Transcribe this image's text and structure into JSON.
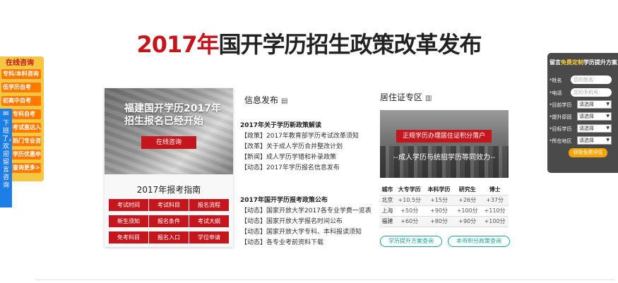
{
  "title": {
    "year": "2017年",
    "rest": "国开学历招生政策改革发布"
  },
  "left_float": {
    "title": "在线咨询",
    "items": [
      "专科/本科咨询",
      "低学历自考",
      "初高中自考",
      "专科自考",
      "考试直达入口",
      "热门专业咨询",
      "学历优惠申请",
      "查询更多>>"
    ],
    "strip_text": "下班了，欢迎留言咨询"
  },
  "right_float": {
    "header_pre": "留言",
    "header_hl": "免费定制",
    "header_post": "学历提升方案",
    "name_label": "*姓名",
    "name_placeholder": "您的姓名：",
    "phone_label": "*电话",
    "phone_placeholder": "您的手机号：",
    "rows": [
      {
        "label": "*目前学历",
        "value": "请选择"
      },
      {
        "label": "*提升原因",
        "value": "请选择"
      },
      {
        "label": "*目标学历",
        "value": "请选择"
      },
      {
        "label": "*所在地区",
        "value": "请选择"
      }
    ],
    "submit": "获取免费评估"
  },
  "left_card": {
    "photo_title": "福建国开学历2017年招生报名已经开始",
    "consult_button": "在线咨询",
    "guide_title": "2017年报考指南",
    "buttons": [
      "考试时间",
      "考试科目",
      "报名流程",
      "新生须知",
      "报名条件",
      "考试大纲",
      "免考科目",
      "报名入口",
      "学位申请"
    ]
  },
  "news": {
    "header": "信息发布",
    "section1_title": "2017年关于学历新政策解读",
    "section1_items": [
      "【政策】2017年教育部学历考试改革须知",
      "【改革】关于成人学历合并整改计划",
      "【新闻】成人学历学错和补录政策",
      "【动态】2017年学历报名信息发布"
    ],
    "section2_title": "2017年国开学历报考政策公布",
    "section2_items": [
      "【动态】国家开放大学2017各专业学费一览表",
      "【动态】国家开放大学报名时间公布",
      "【动态】国家开放大学专科、本科报读须知",
      "【动态】各专业考前资料下载"
    ]
  },
  "residence": {
    "header": "居住证专区",
    "banner_button": "正规学历办理居住证积分落户",
    "banner_sub": "--成人学历与统招学历等同效力--",
    "columns": [
      "城市",
      "大专学历",
      "本科学历",
      "研究生",
      "博士"
    ],
    "rows": [
      [
        "北京",
        "+10.5分",
        "+15分",
        "+26分",
        "+37分"
      ],
      [
        "上海",
        "+50分",
        "+90分",
        "+100分",
        "+110分"
      ],
      [
        "福建",
        "+60分",
        "+80分",
        "+90分",
        "+100分"
      ]
    ],
    "pill_left": "学历提升方案查询",
    "pill_right": "本市积分政策查询"
  }
}
